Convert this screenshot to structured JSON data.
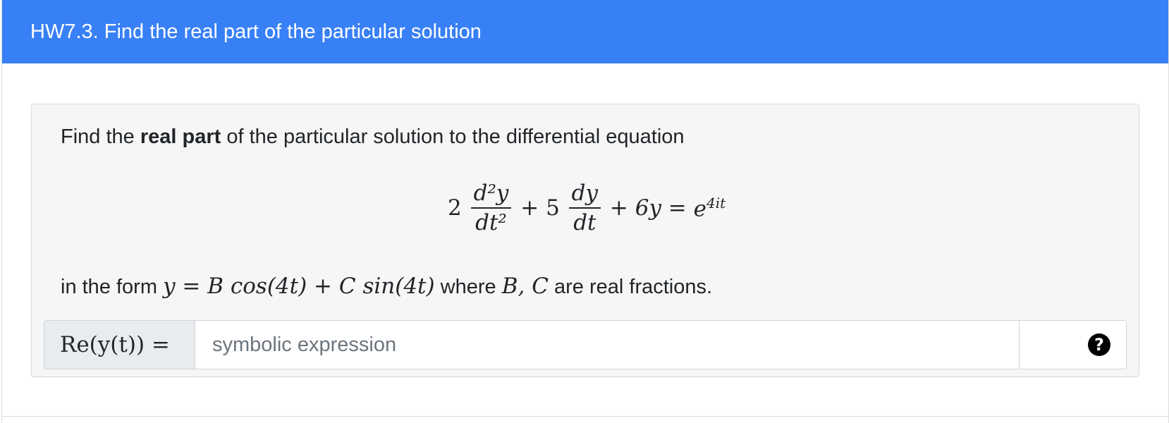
{
  "card": {
    "title": "HW7.3. Find the real part of the particular solution",
    "header_color": "#3880f6"
  },
  "question": {
    "prompt_prefix": "Find the ",
    "prompt_bold": "real part",
    "prompt_suffix": " of the particular solution to the differential equation",
    "equation": {
      "coef1": "2",
      "frac1_num": "d²y",
      "frac1_den": "dt²",
      "plus1": "+ 5",
      "frac2_num": "dy",
      "frac2_den": "dt",
      "rest": "+ 6y = ",
      "rhs_base": "e",
      "rhs_exp": "4it"
    },
    "form_prefix": "in the form ",
    "form_math": "y = B cos(4t) + C sin(4t)",
    "form_where": " where ",
    "form_vars": "B, C",
    "form_suffix": " are real fractions."
  },
  "answer": {
    "label": "Re(y(t)) =",
    "placeholder": "symbolic expression",
    "value": "",
    "help_icon": "question-circle-icon",
    "help_glyph": "?"
  }
}
